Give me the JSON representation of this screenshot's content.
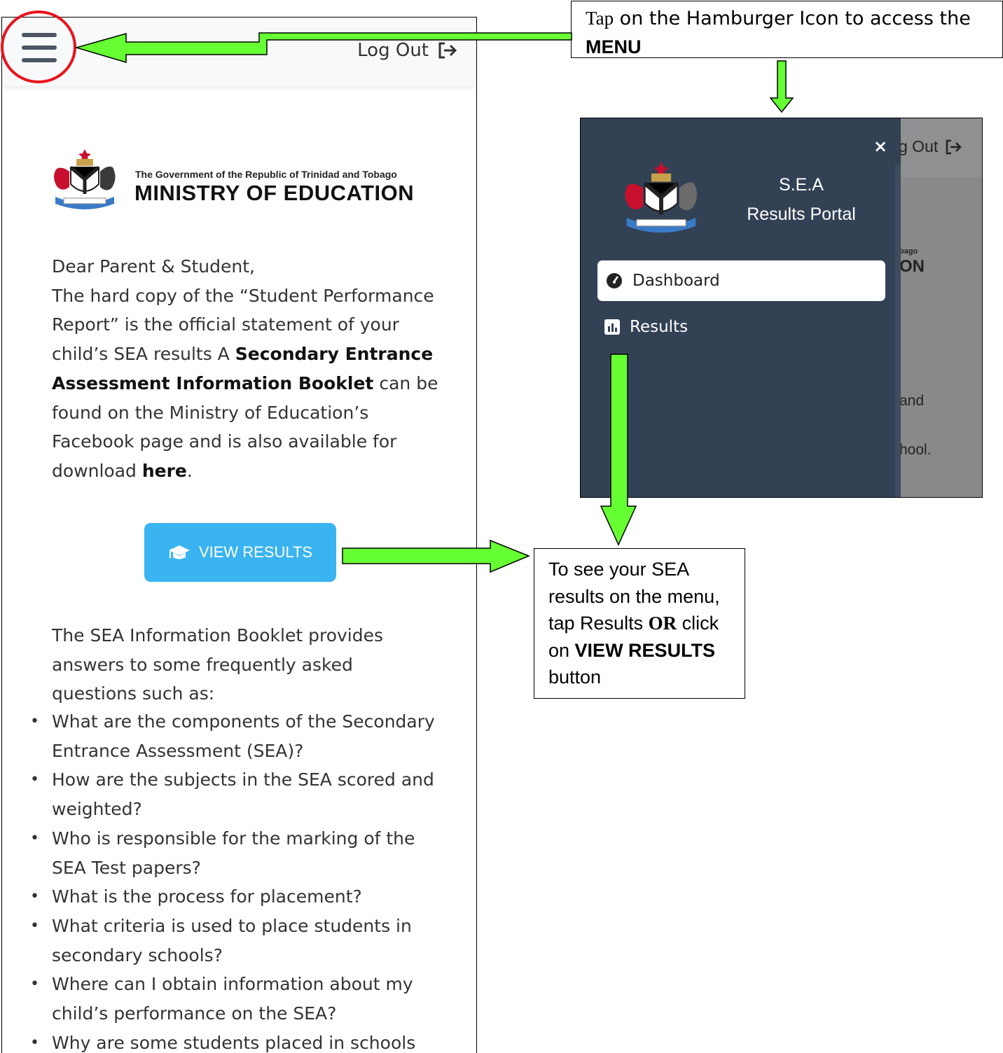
{
  "phone": {
    "logout_label": "Log Out",
    "logo": {
      "gov_line": "The Government of the Republic of Trinidad and Tobago",
      "ministry_line": "MINISTRY OF EDUCATION"
    },
    "letter": {
      "greeting": "Dear Parent & Student,",
      "p1": "The hard copy of the “Student Performance Report” is the official statement of your child’s SEA results  A ",
      "bold1": "Secondary Entrance Assessment Information Booklet",
      "p2": " can be found on the Ministry of Education’s Facebook page and is also available for download ",
      "link_here": "here",
      "p3": "."
    },
    "view_results_label": "VIEW RESULTS",
    "faq_intro": "The SEA Information Booklet provides answers to some frequently asked questions such as:",
    "faq_items": [
      "What are the components of the Secondary Entrance Assessment (SEA)?",
      "How are the subjects in the SEA scored and weighted?",
      "Who is responsible for the marking of the SEA Test papers?",
      "What is the process for placement?",
      "What criteria is used to place students in secondary schools?",
      "Where can I obtain information about my child’s performance on the SEA?",
      "Why are some students placed in schools"
    ]
  },
  "callout_menu": {
    "text1": "Tap",
    "text2": " on the Hamburger Icon to access the ",
    "bold": "MENU"
  },
  "callout_results": {
    "line1": "To see your SEA results on the menu, tap Results ",
    "or": "OR",
    "mid": " click on ",
    "bold_view": "VIEW RESULTS",
    "end": " button"
  },
  "menu_shot": {
    "close_glyph": "×",
    "portal_line1": "S.E.A",
    "portal_line2": "Results Portal",
    "dashboard_label": "Dashboard",
    "results_label": "Results",
    "bg_logout": "g Out",
    "bg_ago": "bago",
    "bg_on": "ON",
    "bg_and": "and",
    "bg_ool": "hool."
  },
  "colors": {
    "arrow_green": "#66ff33",
    "drawer": "#334155",
    "button_blue": "#39b4f0",
    "highlight_red": "#e8141c"
  },
  "icons": [
    "hamburger-icon",
    "logout-icon",
    "graduation-cap-icon",
    "close-icon",
    "dashboard-gauge-icon",
    "bar-chart-icon",
    "coat-of-arms"
  ]
}
